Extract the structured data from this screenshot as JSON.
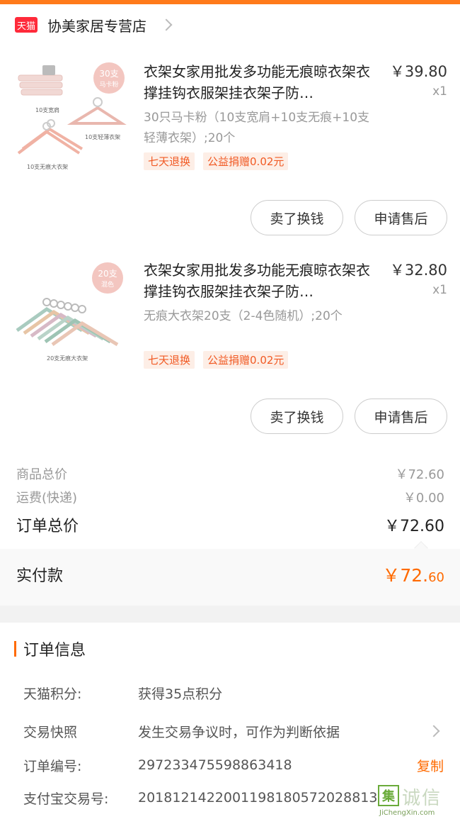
{
  "store": {
    "badge": "天猫",
    "name": "协美家居专营店"
  },
  "items": [
    {
      "title": "衣架女家用批发多功能无痕晾衣架衣撑挂钩衣服架挂衣架子防…",
      "price": "￥39.80",
      "qty": "x1",
      "sku": "30只马卡粉（10支宽肩+10支无痕+10支轻薄衣架）;20个",
      "tags": [
        "七天退换",
        "公益捐赠0.02元"
      ],
      "thumb": {
        "badge_top": "30支",
        "badge_bottom": "马卡粉",
        "caption1": "10支宽肩",
        "caption2": "10支轻薄衣架",
        "caption3": "10支无痕大衣架"
      },
      "buttons": [
        "卖了换钱",
        "申请售后"
      ]
    },
    {
      "title": "衣架女家用批发多功能无痕晾衣架衣撑挂钩衣服架挂衣架子防…",
      "price": "￥32.80",
      "qty": "x1",
      "sku": "无痕大衣架20支（2-4色随机）;20个",
      "tags": [
        "七天退换",
        "公益捐赠0.02元"
      ],
      "thumb": {
        "badge_top": "20支",
        "badge_bottom": "混色",
        "caption1": "20支无痕大衣架"
      },
      "buttons": [
        "卖了换钱",
        "申请售后"
      ]
    }
  ],
  "summary": {
    "goods_label": "商品总价",
    "goods_value": "￥72.60",
    "shipping_label": "运费(快递)",
    "shipping_value": "￥0.00",
    "total_label": "订单总价",
    "total_value": "￥72.60",
    "paid_label": "实付款",
    "paid_value_int": "￥72.",
    "paid_value_dec": "60"
  },
  "order_info": {
    "title": "订单信息",
    "rows": [
      {
        "key": "天猫积分:",
        "value": "获得35点积分"
      },
      {
        "key": "交易快照",
        "value": "发生交易争议时，可作为判断依据"
      },
      {
        "key": "订单编号:",
        "value": "297233475598863418",
        "action": "复制"
      },
      {
        "key": "支付宝交易号:",
        "value": "2018121422001198180572028813"
      }
    ]
  },
  "watermark": {
    "char": "集",
    "text": "诚信",
    "sub": "JiChengXin.com"
  },
  "colors": {
    "accent": "#ff6a00",
    "tmall_red": "#ff2a3a",
    "tag_text": "#f15a24",
    "tag_bg": "#fdeee6"
  }
}
